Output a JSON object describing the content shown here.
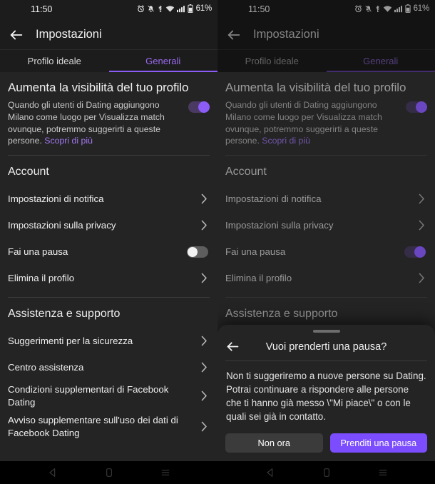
{
  "status_bar": {
    "time": "11:50",
    "battery_percent": "61%",
    "icons": [
      "alarm-icon",
      "bell-muted-icon",
      "bluetooth-icon",
      "wifi-icon",
      "cellular-signal-icon",
      "battery-icon"
    ]
  },
  "app_bar": {
    "back_icon": "back-arrow-icon",
    "title": "Impostazioni"
  },
  "tabs": [
    {
      "label": "Profilo ideale",
      "active": false
    },
    {
      "label": "Generali",
      "active": true
    }
  ],
  "promo": {
    "title": "Aumenta la visibilità del tuo profilo",
    "body": "Quando gli utenti di Dating aggiungono Milano come luogo per Visualizza match ovunque, potremmo suggerirti a queste persone.",
    "link": "Scopri di più",
    "toggle_state": "on"
  },
  "sections": [
    {
      "heading": "Account",
      "rows": [
        {
          "label": "Impostazioni di notifica",
          "control": "chevron"
        },
        {
          "label": "Impostazioni sulla privacy",
          "control": "chevron"
        },
        {
          "label": "Fai una pausa",
          "control": "toggle",
          "left_state": "off",
          "right_state": "on"
        },
        {
          "label": "Elimina il profilo",
          "control": "chevron"
        }
      ]
    },
    {
      "heading": "Assistenza e supporto",
      "rows": [
        {
          "label": "Suggerimenti per la sicurezza",
          "control": "chevron"
        },
        {
          "label": "Centro assistenza",
          "control": "chevron"
        },
        {
          "label": "Condizioni supplementari di Facebook Dating",
          "control": "chevron"
        },
        {
          "label": "Avviso supplementare sull'uso dei dati di Facebook Dating",
          "control": "chevron"
        }
      ]
    }
  ],
  "dialog": {
    "back_icon": "back-arrow-icon",
    "title": "Vuoi prenderti una pausa?",
    "body": "Non ti suggeriremo a nuove persone su Dating. Potrai continuare a rispondere alle persone che ti hanno già messo \\\"Mi piace\\\" o con le quali sei già in contatto.",
    "secondary_button": "Non ora",
    "primary_button": "Prenditi una pausa"
  },
  "nav_bar": {
    "back": "nav-back-icon",
    "home": "nav-home-icon",
    "recents": "nav-recents-icon"
  },
  "colors": {
    "accent_purple": "#8b5cf6",
    "primary_button": "#7c4dff",
    "link_purple": "#a278f0",
    "surface": "#242424",
    "app_bar": "#1c1c1c"
  }
}
